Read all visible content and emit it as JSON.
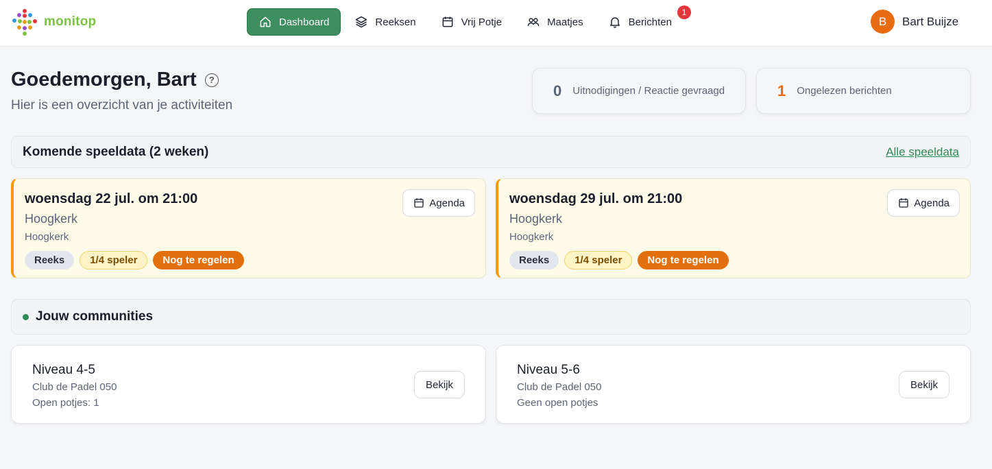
{
  "brand": {
    "name": "monitop"
  },
  "nav": {
    "items": [
      {
        "label": "Dashboard",
        "icon": "home-icon",
        "active": true
      },
      {
        "label": "Reeksen",
        "icon": "layers-icon"
      },
      {
        "label": "Vrij Potje",
        "icon": "calendar-icon"
      },
      {
        "label": "Maatjes",
        "icon": "users-icon"
      },
      {
        "label": "Berichten",
        "icon": "bell-icon",
        "badge": "1"
      }
    ]
  },
  "user": {
    "initial": "B",
    "name": "Bart Buijze"
  },
  "greeting": {
    "title": "Goedemorgen, Bart",
    "subtitle": "Hier is een overzicht van je activiteiten"
  },
  "stats": [
    {
      "value": "0",
      "label": "Uitnodigingen / Reactie gevraagd",
      "color": "#5b6577"
    },
    {
      "value": "1",
      "label": "Ongelezen berichten",
      "color": "#ea6c10"
    }
  ],
  "upcoming": {
    "title": "Komende speeldata (2 weken)",
    "link": "Alle speeldata",
    "agenda_label": "Agenda",
    "matches": [
      {
        "datetime": "woensdag 22 jul. om 21:00",
        "location": "Hoogkerk",
        "sublocation": "Hoogkerk",
        "tags": [
          "Reeks",
          "1/4 speler",
          "Nog te regelen"
        ]
      },
      {
        "datetime": "woensdag 29 jul. om 21:00",
        "location": "Hoogkerk",
        "sublocation": "Hoogkerk",
        "tags": [
          "Reeks",
          "1/4 speler",
          "Nog te regelen"
        ]
      }
    ]
  },
  "communities": {
    "title": "Jouw communities",
    "button_label": "Bekijk",
    "items": [
      {
        "name": "Niveau 4-5",
        "club": "Club de Padel 050",
        "open": "Open potjes: 1"
      },
      {
        "name": "Niveau 5-6",
        "club": "Club de Padel 050",
        "open": "Geen open potjes"
      }
    ]
  }
}
